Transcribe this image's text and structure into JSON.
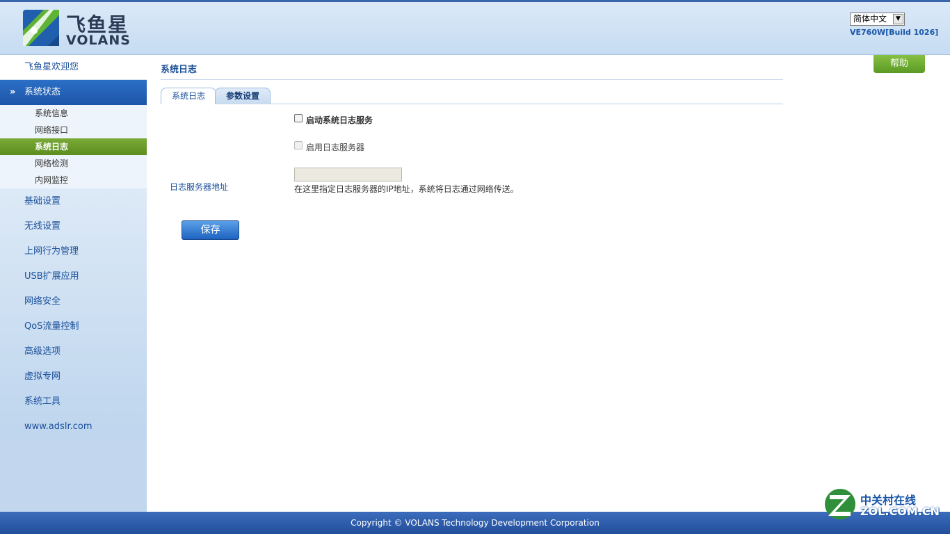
{
  "header": {
    "logo_cn": "飞鱼星",
    "logo_en": "VOLANS",
    "language": "简体中文",
    "version": "VE760W[Build 1026]"
  },
  "sidebar": {
    "welcome": "飞鱼星欢迎您",
    "active_section": "系统状态",
    "sub_items": [
      "系统信息",
      "网络接口",
      "系统日志",
      "网络检测",
      "内网监控"
    ],
    "items": [
      "基础设置",
      "无线设置",
      "上网行为管理",
      "USB扩展应用",
      "网络安全",
      "QoS流量控制",
      "高级选项",
      "虚拟专网",
      "系统工具",
      "www.adslr.com"
    ]
  },
  "content": {
    "page_title": "系统日志",
    "tabs": [
      "系统日志",
      "参数设置"
    ],
    "enable_service_label": "启动系统日志服务",
    "enable_server_label": "启用日志服务器",
    "server_address_label": "日志服务器地址",
    "server_address_value": "",
    "hint": "在这里指定日志服务器的IP地址，系统将日志通过网络传送。",
    "save_label": "保存"
  },
  "help_label": "帮助",
  "footer": {
    "copyright": "Copyright © VOLANS Technology Development Corporation",
    "zol_cn": "中关村在线",
    "zol_en": "ZOL.COM.CN"
  },
  "colors": {
    "accent_blue": "#1d55a8",
    "selected_green": "#5c8d1f",
    "footer_blue": "#2a579f"
  }
}
